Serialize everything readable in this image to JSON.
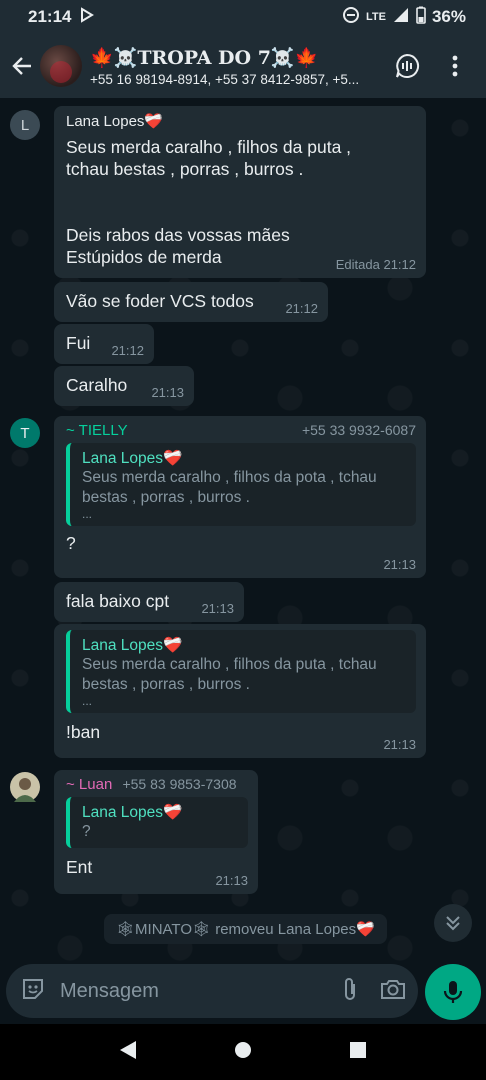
{
  "status_bar": {
    "time": "21:14",
    "network": "LTE",
    "battery": "36%"
  },
  "header": {
    "title": "🍁☠️TROPA DO 7☠️🍁",
    "subtitle": "+55 16 98194-8914, +55 37 8412-9857, +5..."
  },
  "messages": [
    {
      "avatar_letter": "L",
      "sender": "Lana Lopes❤️‍🩹",
      "lines": [
        "Seus merda caralho , filhos da puta ,",
        "tchau bestas , porras , burros .",
        "",
        "",
        "Deis rabos das vossas mães",
        "Estúpidos de merda"
      ],
      "meta": "Editada 21:12"
    },
    {
      "text": "Vão se foder VCS todos",
      "time": "21:12"
    },
    {
      "text": "Fui",
      "time": "21:12"
    },
    {
      "text": "Caralho",
      "time": "21:13"
    },
    {
      "avatar_letter": "T",
      "sender": "~ TIELLY",
      "phone": "+55 33 9932-6087",
      "quote_author": "Lana Lopes❤️‍🩹",
      "quote_lines": [
        "Seus merda caralho , filhos da pota , tchau",
        "bestas , porras , burros .",
        "..."
      ],
      "text": "?",
      "time": "21:13"
    },
    {
      "text": "fala baixo cpt",
      "time": "21:13"
    },
    {
      "quote_author": "Lana Lopes❤️‍🩹",
      "quote_lines": [
        "Seus merda caralho , filhos da puta , tchau",
        "bestas , porras , burros .",
        "..."
      ],
      "text": "!ban",
      "time": "21:13"
    },
    {
      "sender": "~ Luan",
      "phone": "+55 83 9853-7308",
      "quote_author": "Lana Lopes❤️‍🩹",
      "quote_lines": [
        "?"
      ],
      "text": "Ent",
      "time": "21:13"
    }
  ],
  "system_message": "🕸MINATO🕸 removeu Lana Lopes❤️‍🩹",
  "input": {
    "placeholder": "Mensagem"
  },
  "colors": {
    "accent": "#00a884",
    "bubble": "#202c33",
    "quote_bar": "#06cf9c",
    "tielly": "#06cf9c",
    "luan": "#e26ab6"
  },
  "icons": [
    "back-arrow-icon",
    "voice-chat-icon",
    "more-vert-icon",
    "sticker-icon",
    "attach-icon",
    "camera-icon",
    "mic-icon",
    "chevron-double-down-icon"
  ]
}
